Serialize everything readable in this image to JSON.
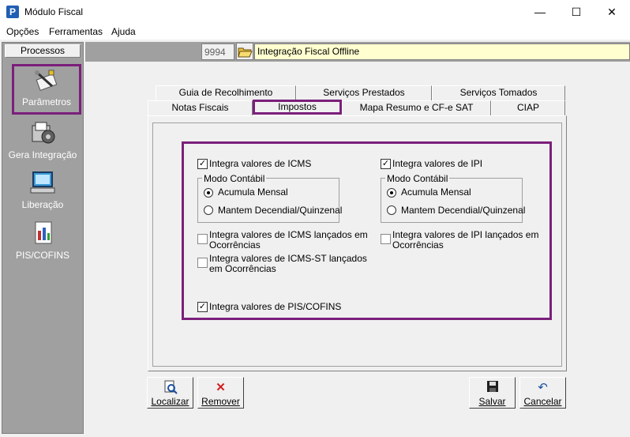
{
  "window": {
    "app_icon_letter": "P",
    "title": "Módulo Fiscal",
    "min_glyph": "—",
    "max_glyph": "☐",
    "close_glyph": "✕"
  },
  "menu": [
    "Opções",
    "Ferramentas",
    "Ajuda"
  ],
  "sidebar": {
    "header": "Processos",
    "items": [
      {
        "label": "Parâmetros",
        "icon": "parameters-icon",
        "selected": true
      },
      {
        "label": "Gera Integração",
        "icon": "generate-integration-icon",
        "selected": false
      },
      {
        "label": "Liberação",
        "icon": "release-computer-icon",
        "selected": false
      },
      {
        "label": "PIS/COFINS",
        "icon": "pis-cofins-document-icon",
        "selected": false
      }
    ]
  },
  "header": {
    "code": "9994",
    "title": "Integração Fiscal Offline"
  },
  "tabs": {
    "row1": [
      "Guia de Recolhimento",
      "Serviços Prestados",
      "Serviços Tomados"
    ],
    "row2": [
      "Notas Fiscais",
      "Impostos",
      "Mapa Resumo e CF-e SAT",
      "CIAP"
    ],
    "active": "Impostos"
  },
  "icms": {
    "checkbox_label": "Integra valores de ICMS",
    "checked": true,
    "group_title": "Modo Contábil",
    "option1": "Acumula Mensal",
    "option2": "Mantem Decendial/Quinzenal",
    "selected": "Acumula Mensal"
  },
  "ipi": {
    "checkbox_label": "Integra valores de IPI",
    "checked": true,
    "group_title": "Modo Contábil",
    "option1": "Acumula Mensal",
    "option2": "Mantem Decendial/Quinzenal",
    "selected": "Acumula Mensal"
  },
  "extra": {
    "icms_ocorrencias_l1": "Integra valores de ICMS lançados em",
    "icms_ocorrencias_l2": "Ocorrências",
    "icms_st_l1": "Integra valores de ICMS-ST lançados",
    "icms_st_l2": "em Ocorrências",
    "ipi_ocorrencias_l1": "Integra valores de IPI lançados em",
    "ipi_ocorrencias_l2": "Ocorrências",
    "pis_cofins": "Integra valores de PIS/COFINS",
    "pis_cofins_checked": true
  },
  "buttons": {
    "localizar": "Localizar",
    "remover": "Remover",
    "salvar": "Salvar",
    "cancelar": "Cancelar"
  },
  "colors": {
    "highlight": "#7b1f7b",
    "sidebar_bg": "#a0a0a0",
    "title_field_bg": "#ffffd0"
  }
}
